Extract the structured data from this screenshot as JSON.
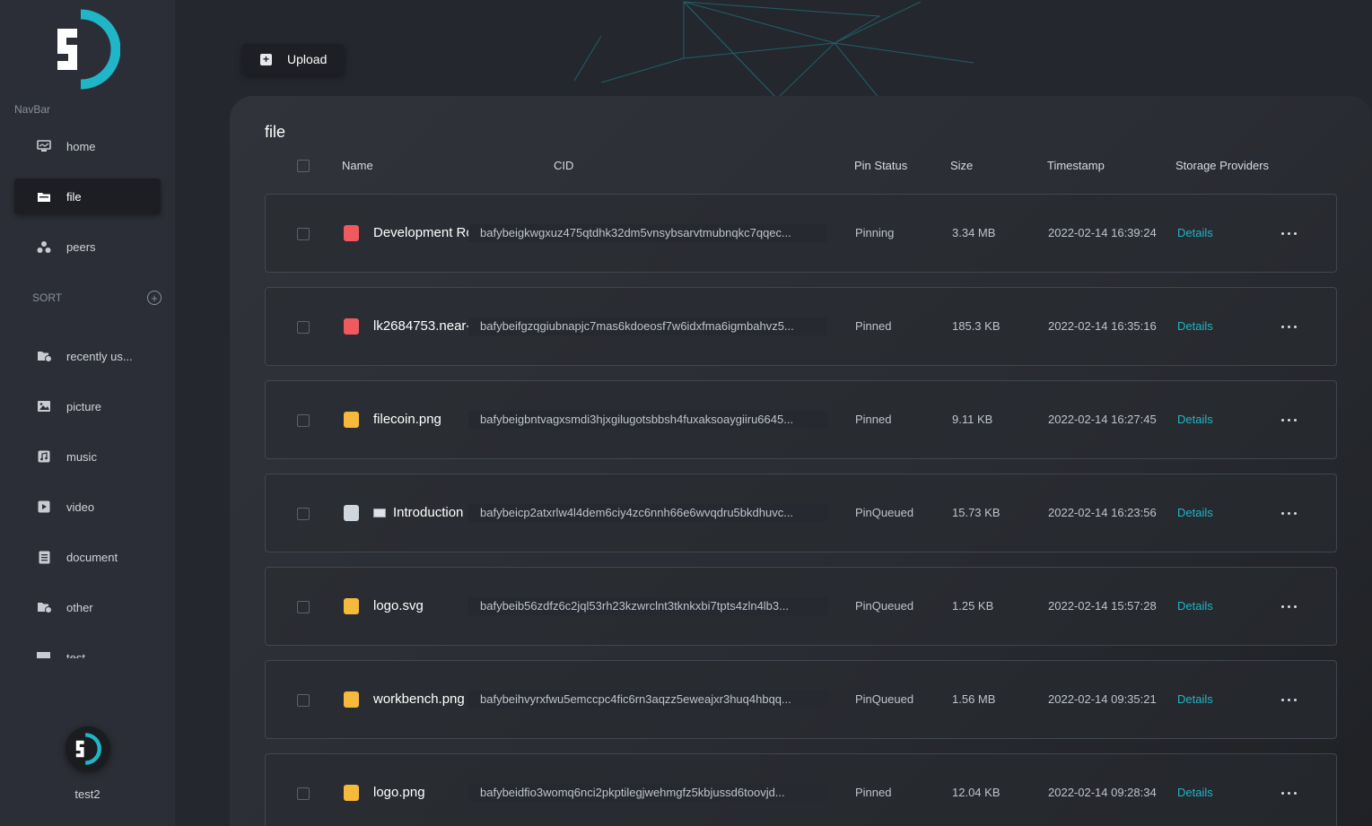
{
  "sidebar": {
    "navbar_label": "NavBar",
    "items": [
      {
        "label": "home",
        "icon": "monitor-icon"
      },
      {
        "label": "file",
        "icon": "folder-icon"
      },
      {
        "label": "peers",
        "icon": "peers-icon"
      }
    ],
    "sort_label": "SORT",
    "sort_items": [
      {
        "label": "recently us...",
        "icon": "folder-clock-icon"
      },
      {
        "label": "picture",
        "icon": "image-icon"
      },
      {
        "label": "music",
        "icon": "music-icon"
      },
      {
        "label": "video",
        "icon": "play-icon"
      },
      {
        "label": "document",
        "icon": "document-icon"
      },
      {
        "label": "other",
        "icon": "folder-other-icon"
      }
    ],
    "cut_item": "test",
    "username": "test2"
  },
  "toolbar": {
    "upload_label": "Upload"
  },
  "panel": {
    "title": "file",
    "columns": {
      "name": "Name",
      "cid": "CID",
      "pin": "Pin Status",
      "size": "Size",
      "timestamp": "Timestamp",
      "providers": "Storage Providers"
    },
    "rows": [
      {
        "name": "Development Roadmap",
        "type": "pdf",
        "cid": "bafybeigkwgxuz475qtdhk32dm5vnsybsarvtmubnqkc7qqec...",
        "pin": "Pinning",
        "size": "3.34 MB",
        "ts": "2022-02-14 16:39:24",
        "details": "Details"
      },
      {
        "name": "lk2684753.near-",
        "type": "pdf",
        "cid": "bafybeifgzqgiubnapjc7mas6kdoeosf7w6idxfma6igmbahvz5...",
        "pin": "Pinned",
        "size": "185.3 KB",
        "ts": "2022-02-14 16:35:16",
        "details": "Details"
      },
      {
        "name": "filecoin.png",
        "type": "img",
        "cid": "bafybeigbntvagxsmdi3hjxgilugotsbbsh4fuxaksoaygiiru6645...",
        "pin": "Pinned",
        "size": "9.11 KB",
        "ts": "2022-02-14 16:27:45",
        "details": "Details"
      },
      {
        "name": "Introduction",
        "type": "doc",
        "cid": "bafybeicp2atxrlw4l4dem6ciy4zc6nnh66e6wvqdru5bkdhuvc...",
        "pin": "PinQueued",
        "size": "15.73 KB",
        "ts": "2022-02-14 16:23:56",
        "details": "Details"
      },
      {
        "name": "logo.svg",
        "type": "img",
        "cid": "bafybeib56zdfz6c2jql53rh23kzwrclnt3tknkxbi7tpts4zln4lb3...",
        "pin": "PinQueued",
        "size": "1.25 KB",
        "ts": "2022-02-14 15:57:28",
        "details": "Details"
      },
      {
        "name": "workbench.png",
        "type": "img",
        "cid": "bafybeihvyrxfwu5emccpc4fic6rn3aqzz5eweajxr3huq4hbqq...",
        "pin": "PinQueued",
        "size": "1.56 MB",
        "ts": "2022-02-14 09:35:21",
        "details": "Details"
      },
      {
        "name": "logo.png",
        "type": "img",
        "cid": "bafybeidfio3womq6nci2pkptilegjwehmgfz5kbjussd6toovjd...",
        "pin": "Pinned",
        "size": "12.04 KB",
        "ts": "2022-02-14 09:28:34",
        "details": "Details"
      }
    ]
  },
  "colors": {
    "accent": "#1fb6c7",
    "pdf": "#f05a5f",
    "image": "#f7b93c"
  }
}
